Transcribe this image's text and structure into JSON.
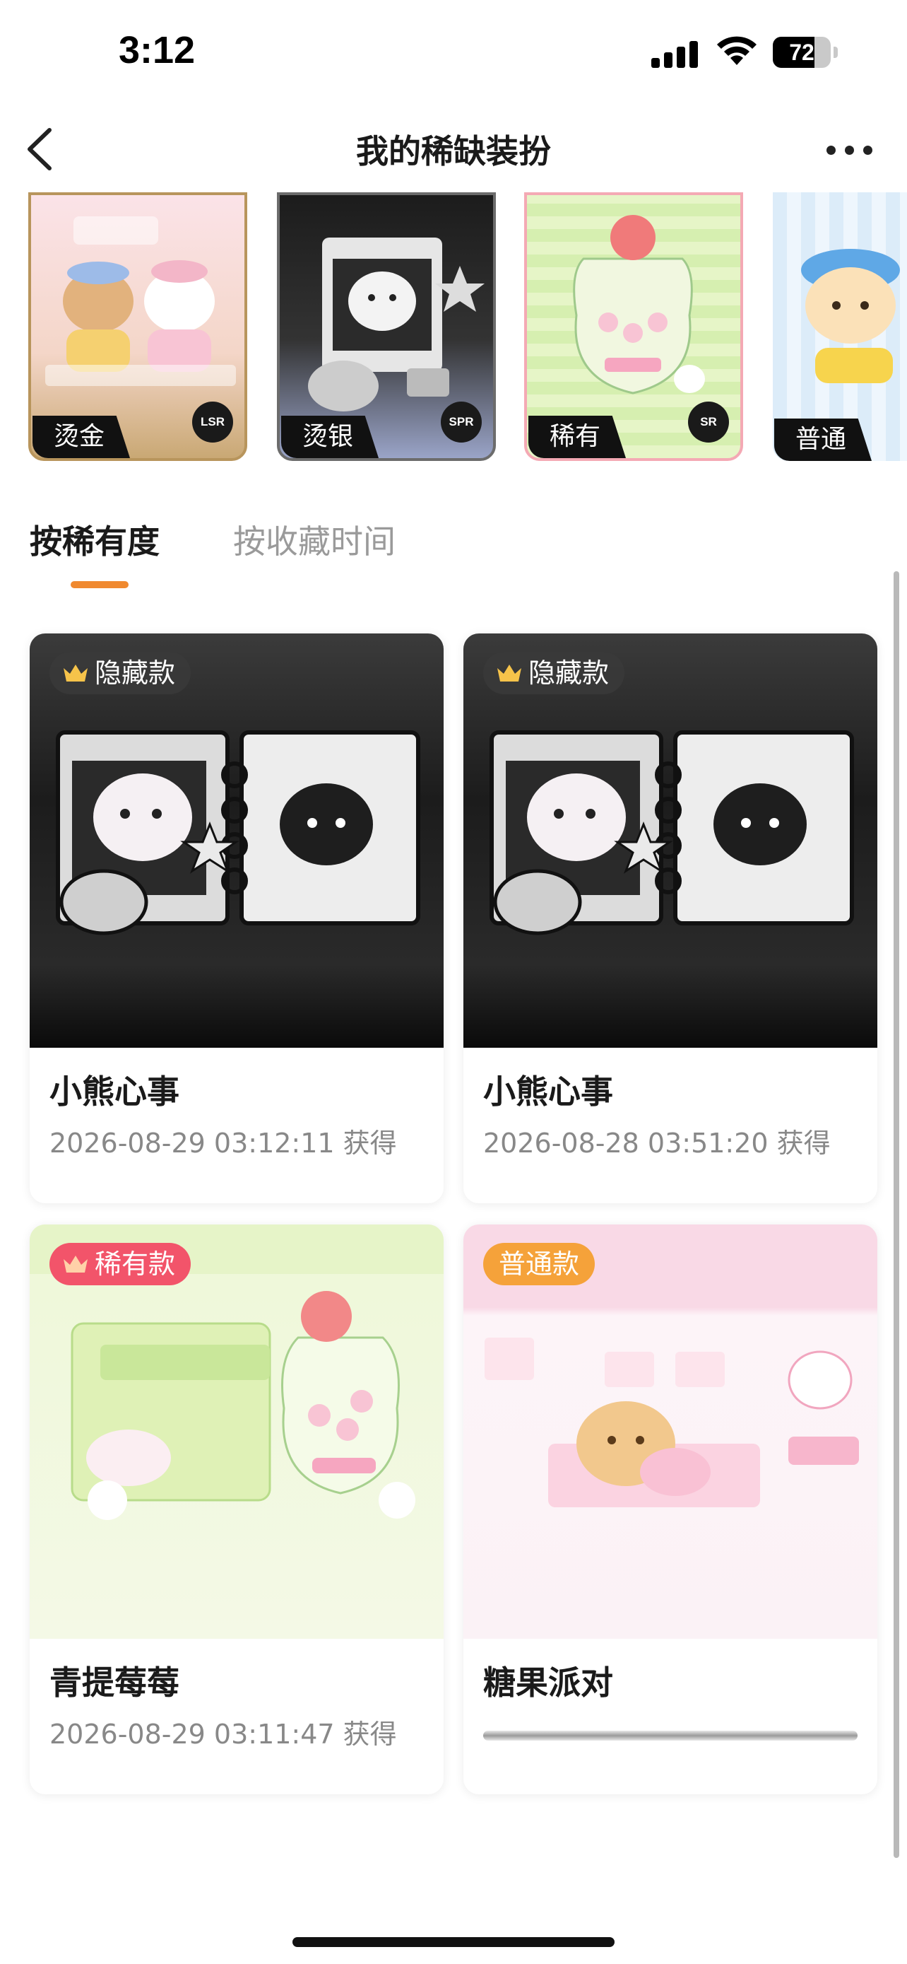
{
  "status_bar": {
    "time": "3:12",
    "battery": "72",
    "battery_level": 0.72
  },
  "nav": {
    "title": "我的稀缺装扮"
  },
  "carousel": {
    "items": [
      {
        "tag": "烫金",
        "badge": "LSR"
      },
      {
        "tag": "烫银",
        "badge": "SPR"
      },
      {
        "tag": "稀有",
        "badge": "SR"
      },
      {
        "tag": "普通",
        "badge": ""
      }
    ]
  },
  "tabs": {
    "active": "按稀有度",
    "inactive": "按收藏时间"
  },
  "cards": [
    {
      "pill": "隐藏款",
      "pill_color": "#3a3a3a",
      "name": "小熊心事",
      "date": "2026-08-29 03:12:11 获得"
    },
    {
      "pill": "隐藏款",
      "pill_color": "#3a3a3a",
      "name": "小熊心事",
      "date": "2026-08-28 03:51:20 获得"
    },
    {
      "pill": "稀有款",
      "pill_color": "#f2546a",
      "name": "青提莓莓",
      "date": "2026-08-29 03:11:47 获得"
    },
    {
      "pill": "普通款",
      "pill_color": "#f5a23a",
      "name": "糖果派对",
      "date": ""
    }
  ],
  "colors": {
    "accent": "#f0892f",
    "rare": "#f2546a",
    "common": "#f5a23a",
    "hidden": "#3a3a3a"
  },
  "icons": [
    "back-icon",
    "more-icon",
    "crown-icon",
    "signal-icon",
    "wifi-icon",
    "battery-icon"
  ]
}
